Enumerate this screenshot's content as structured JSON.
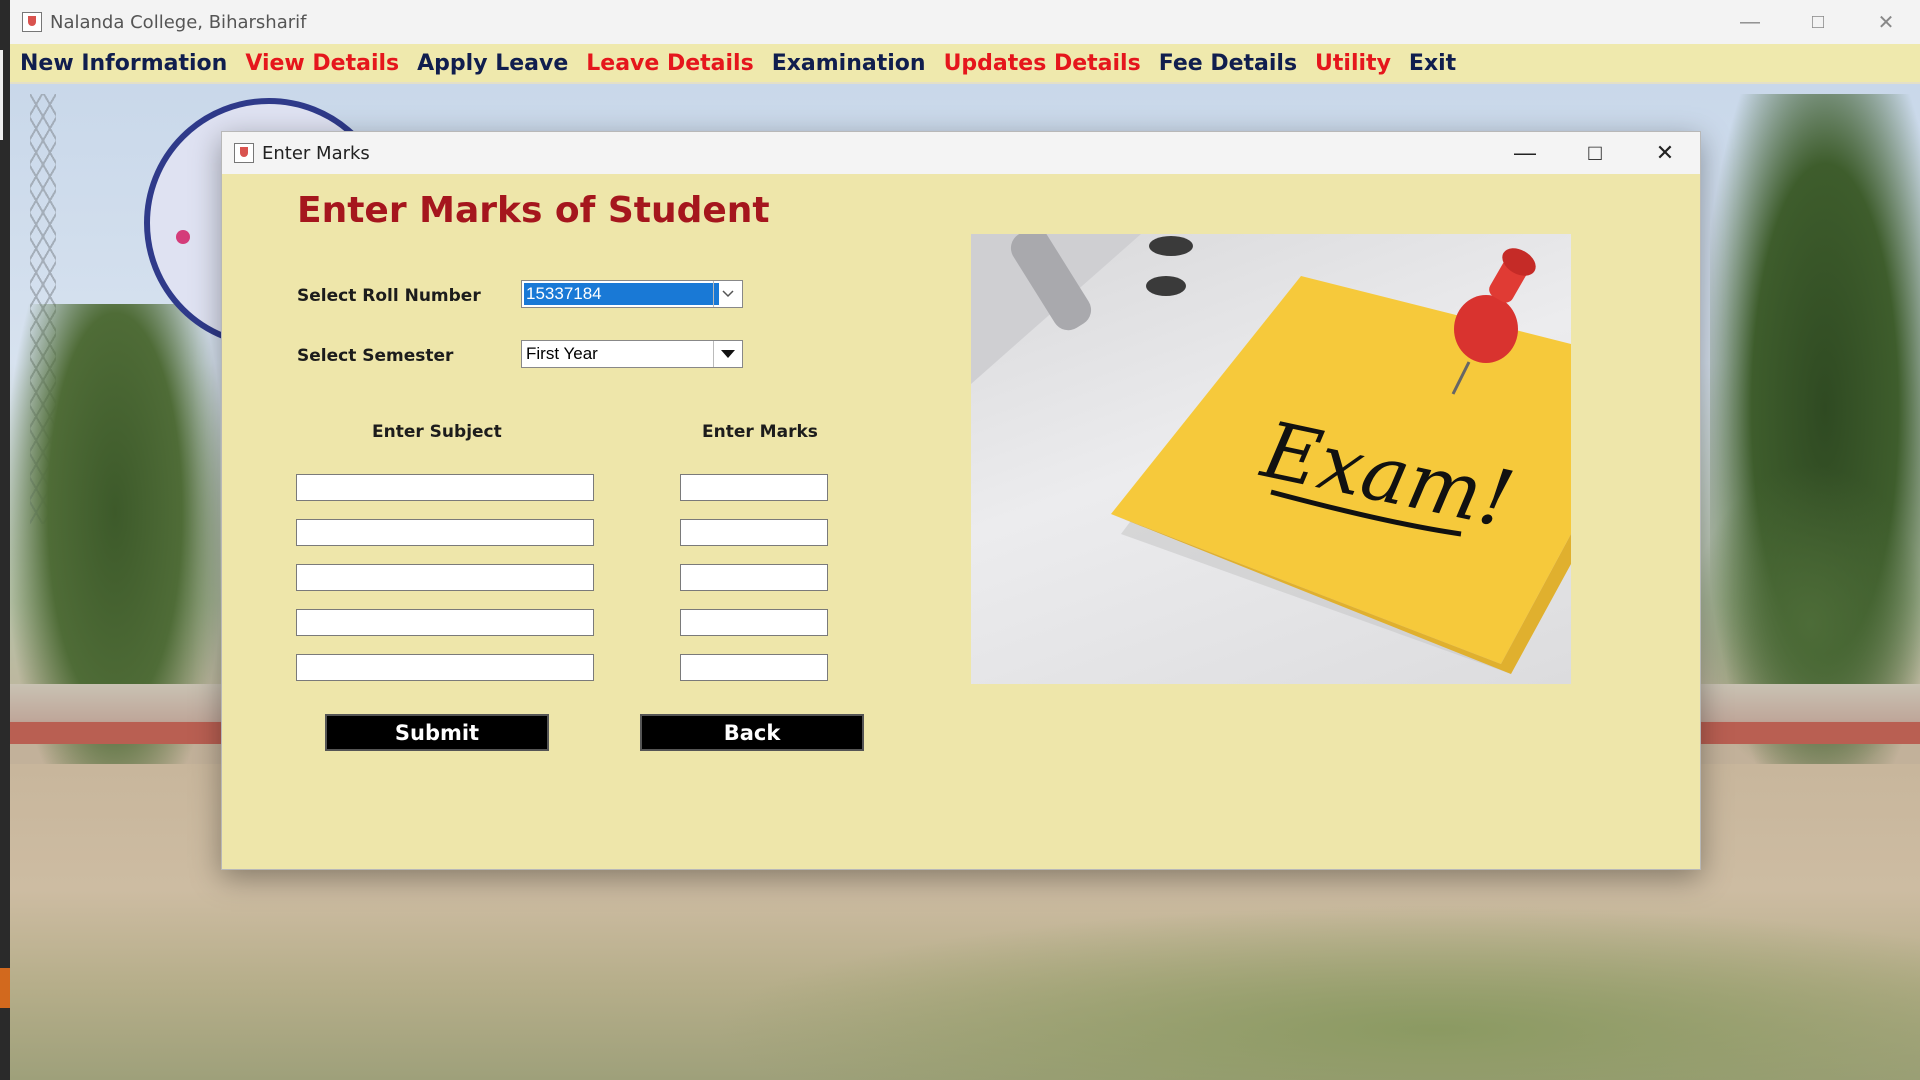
{
  "window": {
    "title": "Nalanda College, Biharsharif",
    "controls": [
      "minimize-icon",
      "maximize-icon",
      "close-icon"
    ]
  },
  "menu": {
    "items": [
      {
        "label": "New Information",
        "color": "#101e4e"
      },
      {
        "label": "View Details",
        "color": "#e5161c"
      },
      {
        "label": "Apply Leave",
        "color": "#101e4e"
      },
      {
        "label": "Leave Details",
        "color": "#e5161c"
      },
      {
        "label": "Examination",
        "color": "#101e4e"
      },
      {
        "label": "Updates Details",
        "color": "#e5161c"
      },
      {
        "label": "Fee Details",
        "color": "#101e4e"
      },
      {
        "label": "Utility",
        "color": "#e5161c"
      },
      {
        "label": "Exit",
        "color": "#101e4e"
      }
    ]
  },
  "dialog": {
    "title": "Enter Marks",
    "heading": "Enter Marks of Student",
    "roll": {
      "label": "Select Roll Number",
      "value": "15337184"
    },
    "semester": {
      "label": "Select Semester",
      "value": "First Year"
    },
    "subject_header": "Enter Subject",
    "marks_header": "Enter Marks",
    "rows": [
      {
        "subject": "",
        "marks": ""
      },
      {
        "subject": "",
        "marks": ""
      },
      {
        "subject": "",
        "marks": ""
      },
      {
        "subject": "",
        "marks": ""
      },
      {
        "subject": "",
        "marks": ""
      }
    ],
    "submit_label": "Submit",
    "back_label": "Back",
    "image_text": "Exam!"
  },
  "colors": {
    "menu_bg": "#efe9ad",
    "dialog_bg": "#eee6aa",
    "heading": "#a5161d",
    "selection": "#1979d6"
  }
}
